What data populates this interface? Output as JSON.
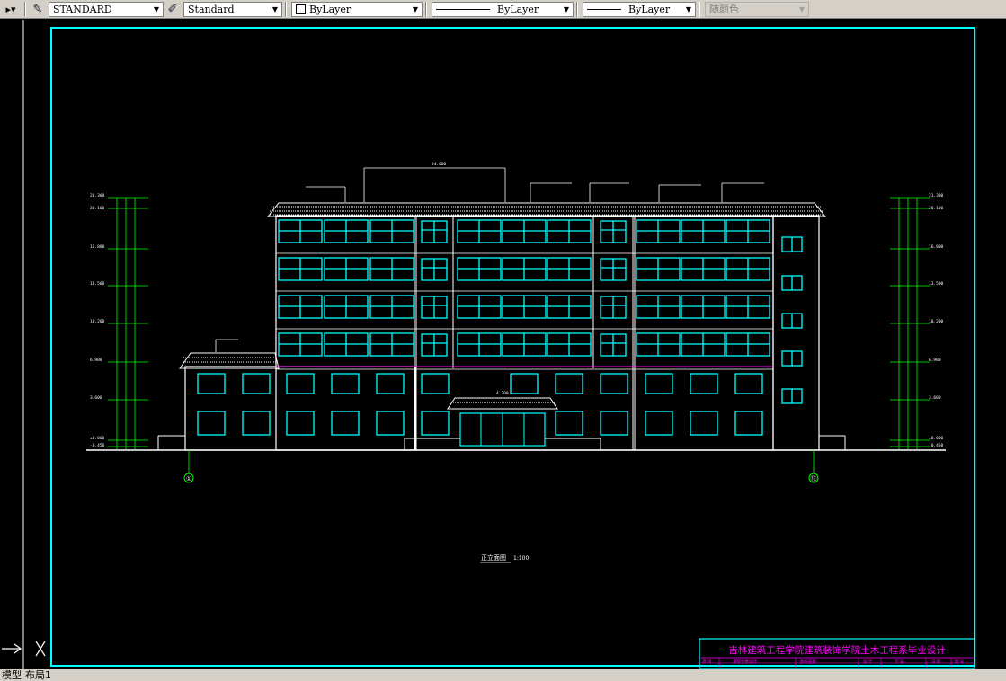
{
  "toolbar": {
    "text_style": "STANDARD",
    "dim_style": "Standard",
    "layer": "ByLayer",
    "linetype": "ByLayer",
    "lineweight": "ByLayer",
    "color": "随颜色"
  },
  "drawing": {
    "axis_left": "①",
    "axis_right": "⑬",
    "elevation_title": "正立面图",
    "elevation_scale": "1:100",
    "top_dim": "24.000",
    "entrance_level": "4.200",
    "left_levels": [
      "21.300",
      "20.100",
      "16.800",
      "13.500",
      "10.200",
      "6.900",
      "3.600",
      "±0.000",
      "-0.450"
    ],
    "right_levels": [
      "21.300",
      "20.100",
      "16.800",
      "13.500",
      "10.200",
      "6.900",
      "3.600",
      "±0.000",
      "-0.450"
    ]
  },
  "title_block": {
    "school": "吉林建筑工程学院建筑装饰学院土木工程系毕业设计",
    "row_labels": [
      "项 目",
      "某综合楼设计",
      "图纸名称",
      "设 计",
      "学 号",
      "日 期",
      "图 号"
    ]
  },
  "tabs": [
    "模型",
    "布局1"
  ],
  "colors": {
    "background": "#000000",
    "frame": "#00ffff",
    "building": "#ffffff",
    "window": "#00ffff",
    "dims": "#00ff00",
    "accent": "#ff00ff"
  }
}
